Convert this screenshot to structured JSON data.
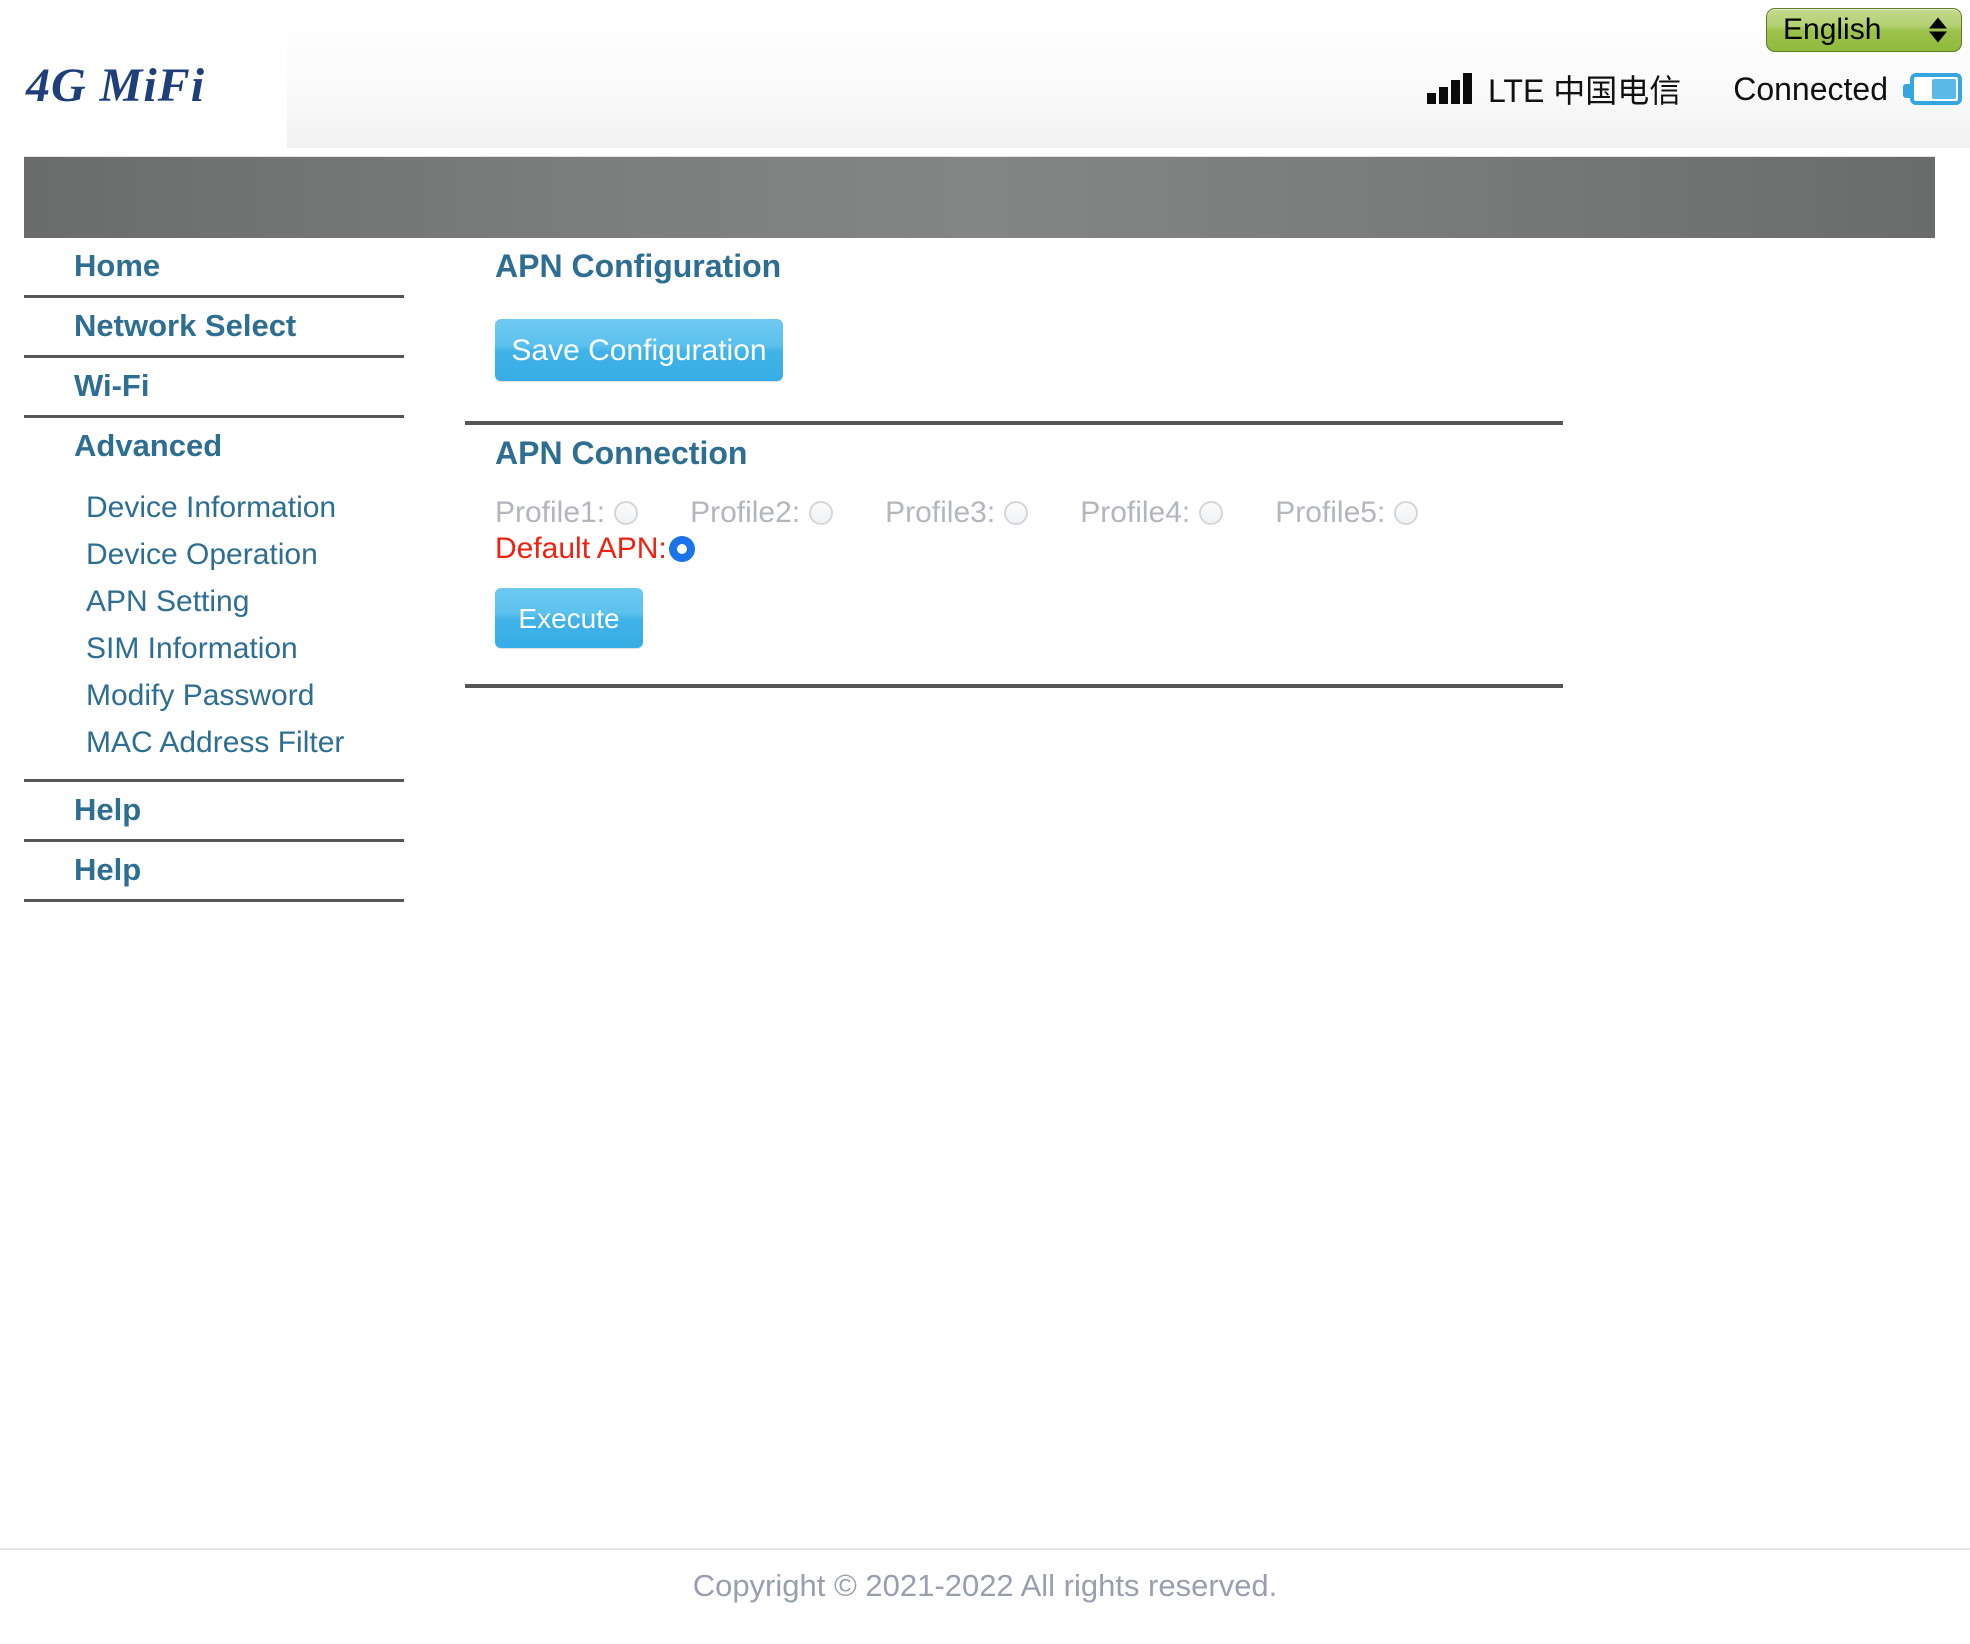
{
  "header": {
    "logo_text": "4G MiFi",
    "language": {
      "selected": "English",
      "up_icon": "triangle-up-icon",
      "down_icon": "triangle-down-icon"
    },
    "status": {
      "signal_icon": "signal-bars-icon",
      "network": "LTE 中国电信",
      "connection": "Connected",
      "battery_icon": "battery-half-icon"
    }
  },
  "sidebar": {
    "items": [
      {
        "label": "Home"
      },
      {
        "label": "Network Select"
      },
      {
        "label": "Wi-Fi"
      },
      {
        "label": "Advanced"
      }
    ],
    "sub_items": [
      {
        "label": "Device Information"
      },
      {
        "label": "Device Operation"
      },
      {
        "label": "APN Setting"
      },
      {
        "label": "SIM Information"
      },
      {
        "label": "Modify Password"
      },
      {
        "label": "MAC Address Filter"
      }
    ],
    "help_items": [
      {
        "label": "Help"
      },
      {
        "label": "Help"
      }
    ]
  },
  "main": {
    "apn_configuration": {
      "title": "APN Configuration",
      "save_label": "Save Configuration"
    },
    "apn_connection": {
      "title": "APN Connection",
      "profiles": [
        {
          "label": "Profile1:",
          "selected": false
        },
        {
          "label": "Profile2:",
          "selected": false
        },
        {
          "label": "Profile3:",
          "selected": false
        },
        {
          "label": "Profile4:",
          "selected": false
        },
        {
          "label": "Profile5:",
          "selected": false
        }
      ],
      "default_apn_label": "Default APN:",
      "default_apn_selected": true,
      "execute_label": "Execute"
    }
  },
  "footer": {
    "copyright": "Copyright © 2021-2022 All rights reserved."
  },
  "colors": {
    "accent_blue": "#2e6e93",
    "logo_navy": "#1f3f7a",
    "button_blue": "#41b3e8",
    "alert_red": "#ee2211",
    "banner_gray": "#7c7e7e",
    "lang_green": "#9dc24c",
    "disabled_gray": "#b3b6bd",
    "footer_gray": "#9a9fb0"
  }
}
